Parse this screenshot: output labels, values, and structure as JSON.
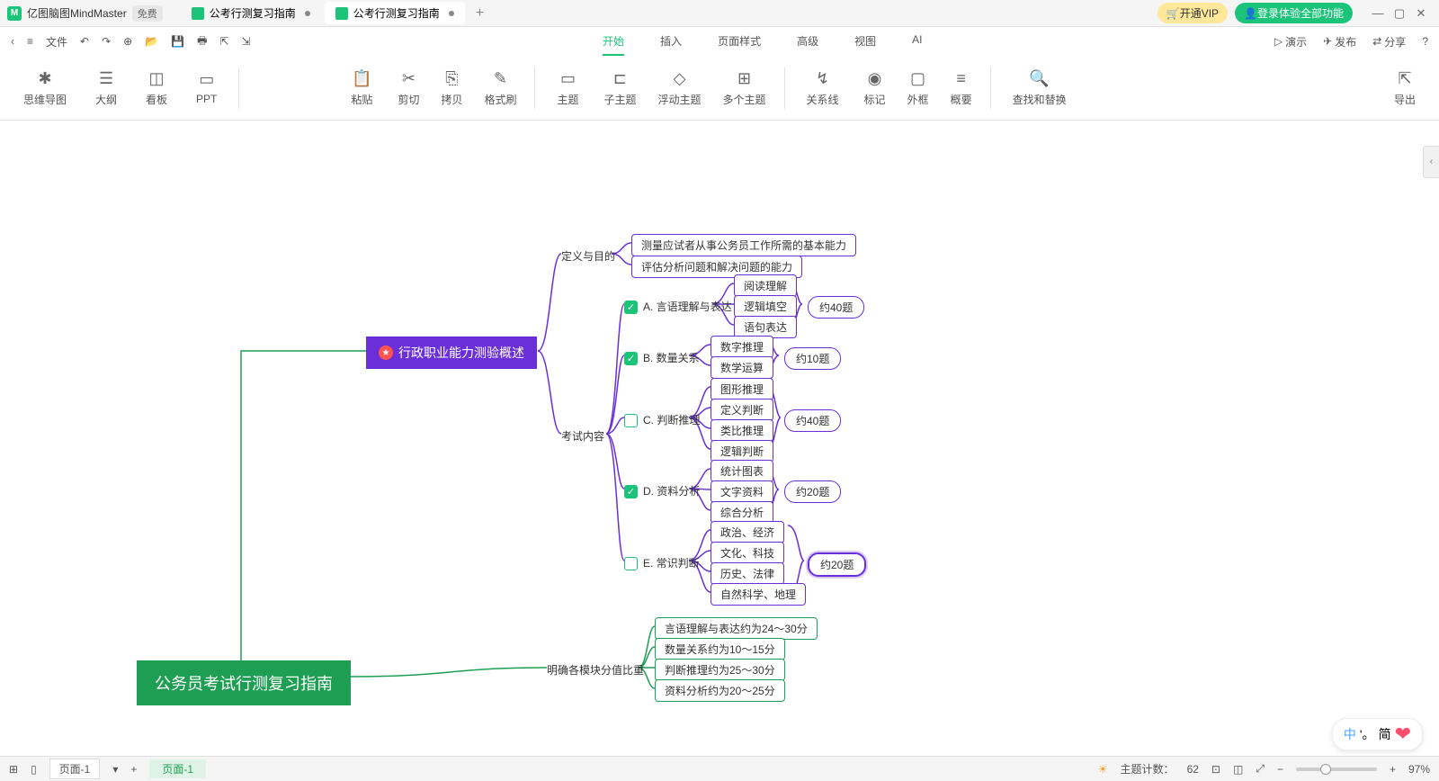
{
  "app": {
    "name": "亿图脑图MindMaster",
    "free": "免费"
  },
  "tabs": [
    {
      "label": "公考行测复习指南"
    },
    {
      "label": "公考行测复习指南"
    }
  ],
  "vip": "开通VIP",
  "login": "登录体验全部功能",
  "menu": {
    "file": "文件",
    "start": "开始",
    "insert": "插入",
    "page": "页面样式",
    "adv": "高级",
    "view": "视图",
    "ai": "AI"
  },
  "actions": {
    "present": "演示",
    "publish": "发布",
    "share": "分享"
  },
  "ribbon": {
    "mind": "思维导图",
    "outline": "大纲",
    "board": "看板",
    "ppt": "PPT",
    "paste": "粘贴",
    "cut": "剪切",
    "copy": "拷贝",
    "fmt": "格式刷",
    "topic": "主题",
    "sub": "子主题",
    "float": "浮动主题",
    "multi": "多个主题",
    "rel": "关系线",
    "mark": "标记",
    "frame": "外框",
    "summary": "概要",
    "find": "查找和替换",
    "export": "导出"
  },
  "map": {
    "root": "公务员考试行测复习指南",
    "section1": "行政职业能力测验概述",
    "def": "定义与目的",
    "def1": "测量应试者从事公务员工作所需的基本能力",
    "def2": "评估分析问题和解决问题的能力",
    "content": "考试内容",
    "a": "A. 言语理解与表达",
    "a1": "阅读理解",
    "a2": "逻辑填空",
    "a3": "语句表达",
    "aN": "约40题",
    "b": "B. 数量关系",
    "b1": "数字推理",
    "b2": "数学运算",
    "bN": "约10题",
    "c": "C. 判断推理",
    "c1": "图形推理",
    "c2": "定义判断",
    "c3": "类比推理",
    "c4": "逻辑判断",
    "cN": "约40题",
    "d": "D. 资料分析",
    "d1": "统计图表",
    "d2": "文字资料",
    "d3": "综合分析",
    "dN": "约20题",
    "e": "E. 常识判断",
    "e1": "政治、经济",
    "e2": "文化、科技",
    "e3": "历史、法律",
    "e4": "自然科学、地理",
    "eN": "约20题",
    "scores": "明确各模块分值比重",
    "s1": "言语理解与表达约为24～30分",
    "s2": "数量关系约为10～15分",
    "s3": "判断推理约为25～30分",
    "s4": "资料分析约为20～25分"
  },
  "status": {
    "page": "页面-1",
    "pageTab": "页面-1",
    "count_label": "主题计数：",
    "count": "62",
    "zoom": "97%"
  },
  "ime": {
    "lang": "中",
    "punct": "'。",
    "mode": "简"
  }
}
